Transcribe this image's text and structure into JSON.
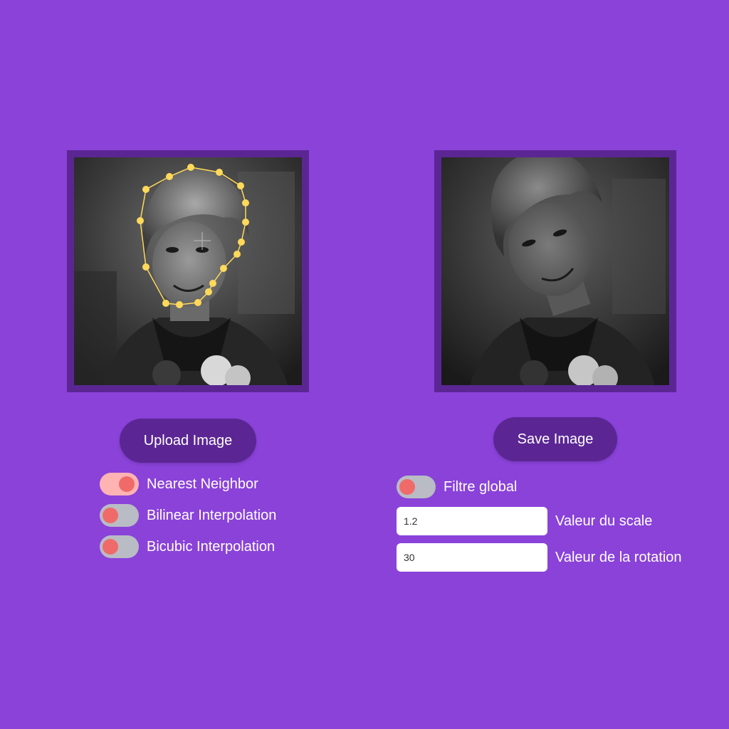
{
  "images": {
    "source_icon": "portrait-photo-with-face-landmarks",
    "result_icon": "transformed-portrait-photo"
  },
  "buttons": {
    "upload_label": "Upload Image",
    "save_label": "Save Image"
  },
  "interpolation": {
    "nearest": {
      "label": "Nearest Neighbor",
      "checked": true
    },
    "bilinear": {
      "label": "Bilinear Interpolation",
      "checked": false
    },
    "bicubic": {
      "label": "Bicubic Interpolation",
      "checked": false
    }
  },
  "filter": {
    "global": {
      "label": "Filtre global",
      "checked": false
    },
    "scale": {
      "value": "1.2",
      "label": "Valeur du scale"
    },
    "rotation": {
      "value": "30",
      "label": "Valeur de la rotation"
    }
  },
  "colors": {
    "background": "#8a42d9",
    "frame": "#5b2694",
    "button": "#5b2694",
    "toggle_off_track": "#b9bcc4",
    "toggle_on_track": "#ffb3b3",
    "toggle_knob": "#f06a6a",
    "landmark": "#ffd95a"
  }
}
